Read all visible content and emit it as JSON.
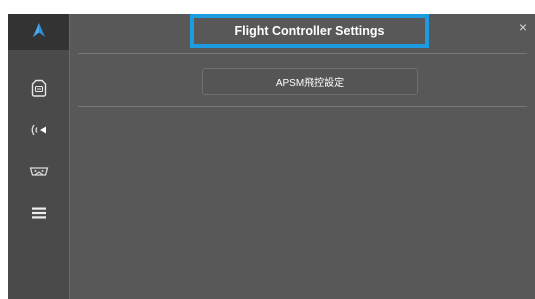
{
  "header": {
    "title": "Flight Controller Settings",
    "close_symbol": "×"
  },
  "tabs": [
    {
      "label": "APSM飛控設定"
    }
  ],
  "sidebar": {
    "items": [
      {
        "icon": "aircraft-logo-icon",
        "active": true
      },
      {
        "icon": "flight-controller-icon",
        "active": false
      },
      {
        "icon": "wireless-signal-icon",
        "active": false
      },
      {
        "icon": "remote-controller-icon",
        "active": false
      },
      {
        "icon": "menu-icon",
        "active": false
      }
    ]
  },
  "colors": {
    "highlight": "#1e9be0",
    "panel": "#585858",
    "sidebar": "#4a4a4a",
    "sidebar_active": "#333333"
  }
}
